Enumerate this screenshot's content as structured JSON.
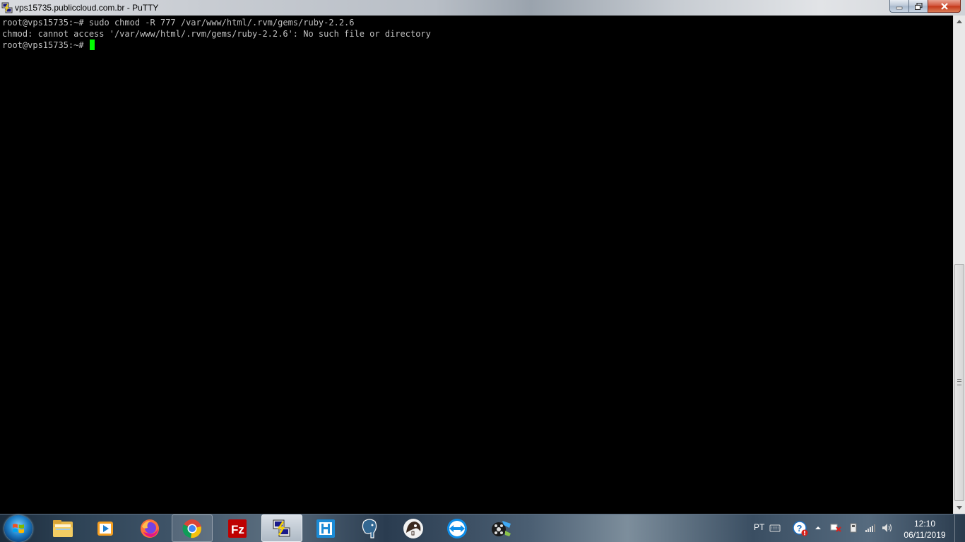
{
  "window": {
    "title": "vps15735.publiccloud.com.br - PuTTY",
    "icon": "putty-icon",
    "buttons": {
      "minimize": "minimize-icon",
      "maximize": "restore-icon",
      "close": "close-icon"
    }
  },
  "terminal": {
    "lines": [
      "root@vps15735:~# sudo chmod -R 777 /var/www/html/.rvm/gems/ruby-2.2.6",
      "chmod: cannot access '/var/www/html/.rvm/gems/ruby-2.2.6': No such file or directory",
      "root@vps15735:~#"
    ],
    "text_color": "#c0c0c0",
    "background": "#000000",
    "cursor_color": "#00ff00"
  },
  "taskbar": {
    "start": "windows-start-orb",
    "items": [
      {
        "name": "file-explorer-icon",
        "state": "normal"
      },
      {
        "name": "media-player-icon",
        "state": "normal"
      },
      {
        "name": "firefox-icon",
        "state": "normal"
      },
      {
        "name": "chrome-icon",
        "state": "open"
      },
      {
        "name": "filezilla-icon",
        "state": "normal"
      },
      {
        "name": "putty-icon",
        "state": "active"
      },
      {
        "name": "app-h-icon",
        "state": "normal"
      },
      {
        "name": "postgresql-icon",
        "state": "normal"
      },
      {
        "name": "dbeaver-icon",
        "state": "normal"
      },
      {
        "name": "teamviewer-icon",
        "state": "normal"
      },
      {
        "name": "video-editor-icon",
        "state": "normal"
      }
    ],
    "tray": {
      "language": "PT",
      "icons": [
        "keyboard-icon",
        "help-alert-icon",
        "show-hidden-icons-arrow",
        "network-alert-icon",
        "usb-device-icon",
        "signal-icon",
        "volume-icon"
      ],
      "time": "12:10",
      "date": "06/11/2019"
    }
  }
}
